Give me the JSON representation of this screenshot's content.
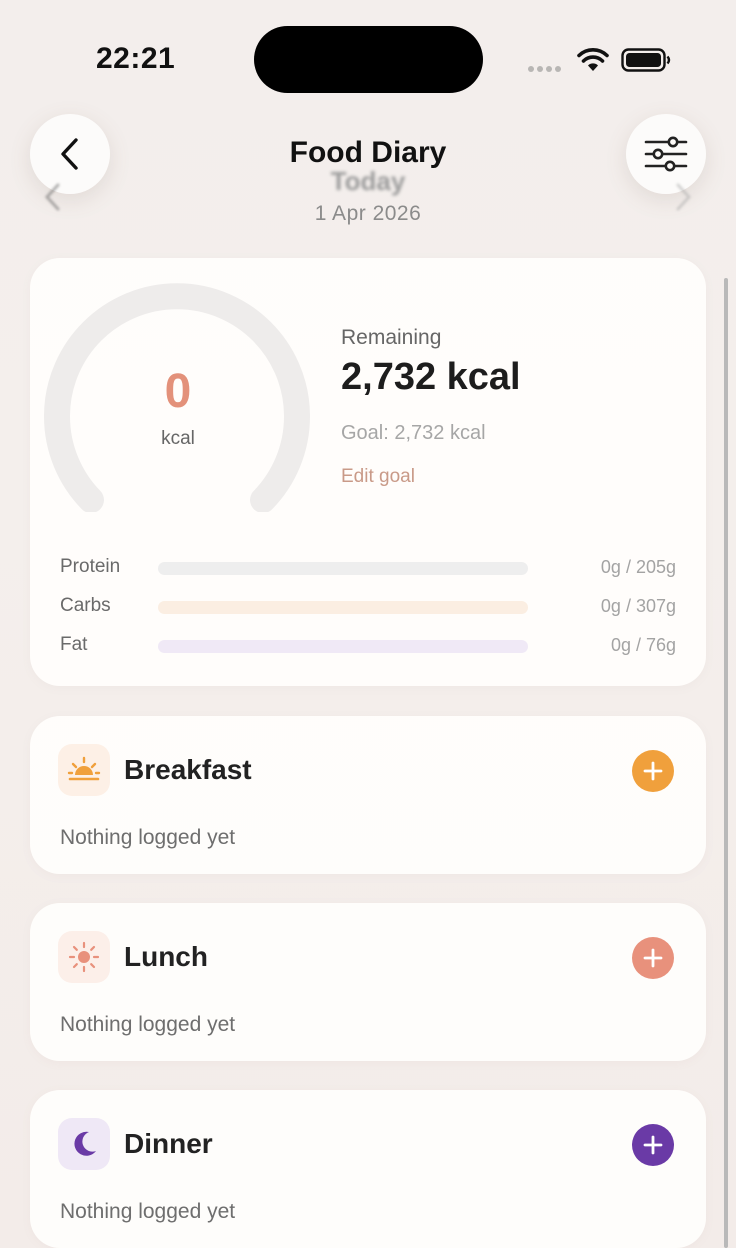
{
  "status_bar": {
    "time": "22:21"
  },
  "header": {
    "title": "Food Diary",
    "day_label": "Today",
    "date": "1 Apr 2026",
    "back_icon": "chevron-left-icon",
    "filter_icon": "sliders-icon"
  },
  "summary": {
    "consumed_value": "0",
    "consumed_unit": "kcal",
    "consumed_fraction": 0,
    "remaining_label": "Remaining",
    "remaining_value": "2,732 kcal",
    "goal_text": "Goal: 2,732 kcal",
    "edit_goal_label": "Edit goal",
    "accent_color": "#e3917a"
  },
  "macros": [
    {
      "name": "Protein",
      "amount": "0g / 205g",
      "fraction": 0,
      "track_color": "#eeeeee"
    },
    {
      "name": "Carbs",
      "amount": "0g / 307g",
      "fraction": 0,
      "track_color": "#fbeee2"
    },
    {
      "name": "Fat",
      "amount": "0g / 76g",
      "fraction": 0,
      "track_color": "#f0e9f6"
    }
  ],
  "meals": [
    {
      "title": "Breakfast",
      "empty_text": "Nothing logged yet",
      "icon": "sunrise-icon",
      "accent": "#f0a03c",
      "icon_bg": "#fdf0e6"
    },
    {
      "title": "Lunch",
      "empty_text": "Nothing logged yet",
      "icon": "sun-icon",
      "accent": "#e8917c",
      "icon_bg": "#fcefe9"
    },
    {
      "title": "Dinner",
      "empty_text": "Nothing logged yet",
      "icon": "moon-icon",
      "accent": "#6a3aa6",
      "icon_bg": "#efe8f6"
    }
  ]
}
